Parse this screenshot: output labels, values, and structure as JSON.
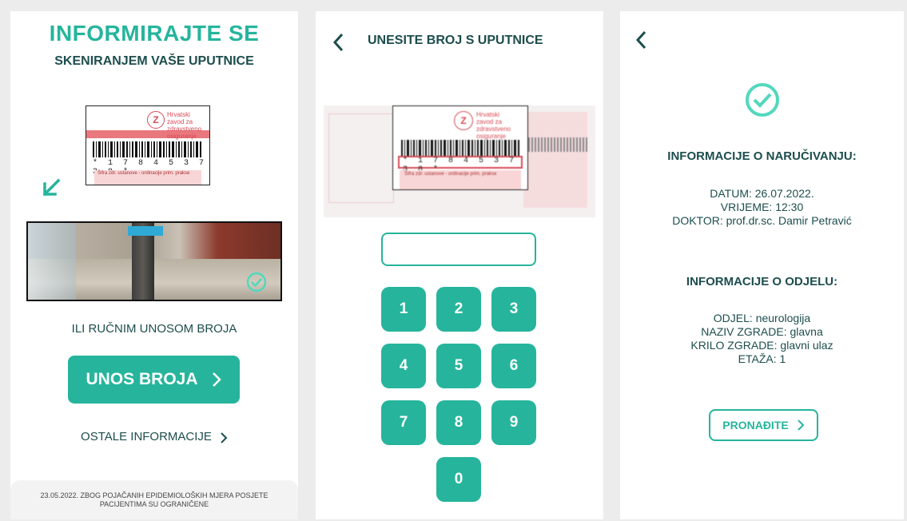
{
  "screen1": {
    "title": "INFORMIRAJTE SE",
    "subtitle": "SKENIRANJEM VAŠE UPUTNICE",
    "card_logo_lines": [
      "Hrvatski",
      "zavod za",
      "zdravstveno",
      "osiguranje"
    ],
    "barcode_number": "* 1 7 8 4 5 3 7 3 8 *",
    "card_field_label": "Šifra zdr. ustanove - ordinacije prim. prakse",
    "or_text": "ILI RUČNIM UNOSOM BROJA",
    "enter_button": "UNOS BROJA",
    "other_info_link": "OSTALE INFORMACIJE",
    "footer_line1": "23.05.2022. ZBOG POJAČANIH EPIDEMIOLOŠKIH MJERA POSJETE",
    "footer_line2": "PACIJENTIMA SU OGRANIČENE",
    "accent_color": "#26b59c"
  },
  "screen2": {
    "title": "UNESITE BROJ S UPUTNICE",
    "card_logo_lines": [
      "Hrvatski",
      "zavod za",
      "zdravstveno",
      "osiguranje"
    ],
    "barcode_number": "* 1 7 8 4 5 3 7 3 8 *",
    "card_field_label": "Šifra zdr. ustanove - ordinacije prim. prakse",
    "input_value": "",
    "keys": [
      "1",
      "2",
      "3",
      "4",
      "5",
      "6",
      "7",
      "8",
      "9",
      "0"
    ]
  },
  "screen3": {
    "booking_heading": "INFORMACIJE O NARUČIVANJU:",
    "date_line": "DATUM: 26.07.2022.",
    "time_line": "VRIJEME: 12:30",
    "doctor_line": "DOKTOR: prof.dr.sc. Damir Petravić",
    "department_heading": "INFORMACIJE O ODJELU:",
    "dept_line": "ODJEL: neurologija",
    "building_line": "NAZIV ZGRADE: glavna",
    "wing_line": "KRILO ZGRADE: glavni ulaz",
    "floor_line": "ETAŽA: 1",
    "find_button": "PRONAĐITE"
  }
}
